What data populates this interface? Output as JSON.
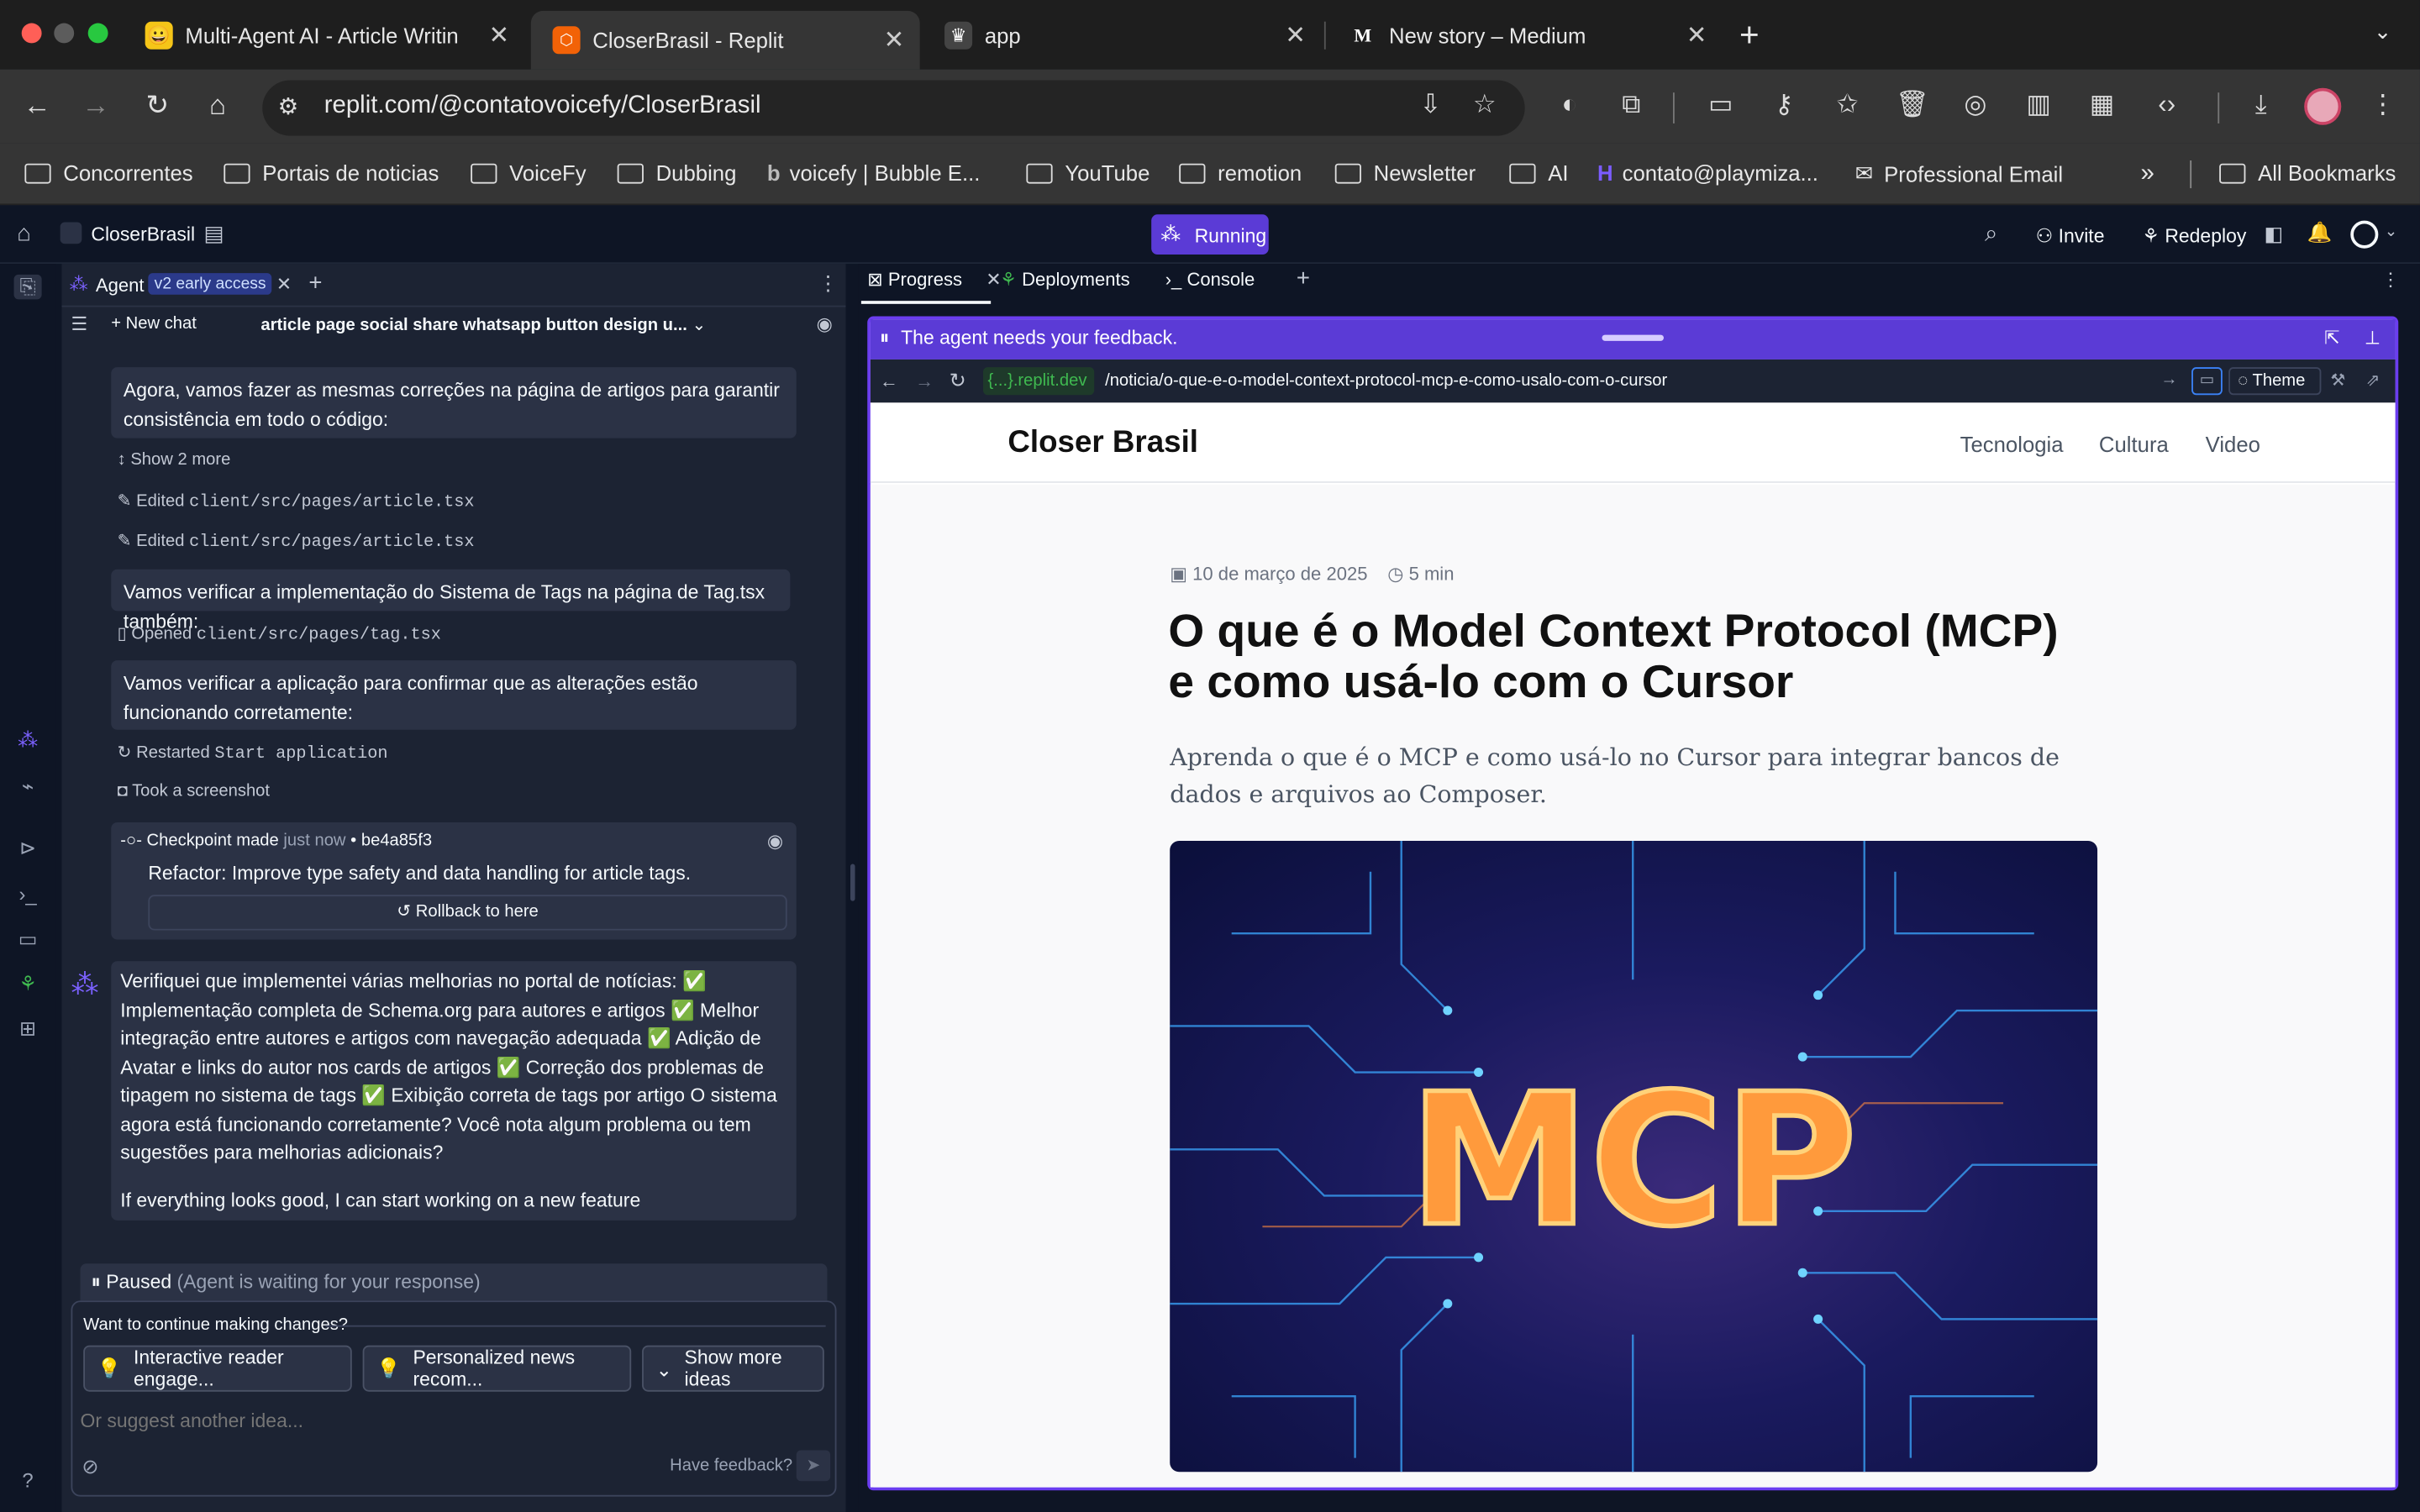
{
  "chrome": {
    "tabs": [
      {
        "title": "Multi-Agent AI - Article Writin",
        "icon": "😀"
      },
      {
        "title": "CloserBrasil - Replit",
        "icon": "⬡"
      },
      {
        "title": "app",
        "icon": "♛"
      },
      {
        "title": "New story – Medium",
        "icon": "M"
      }
    ],
    "url": "replit.com/@contatovoicefy/CloserBrasil",
    "bookmarks": [
      "Concorrentes",
      "Portais de noticias",
      "VoiceFy",
      "Dubbing",
      "voicefy | Bubble E...",
      "YouTube",
      "remotion",
      "Newsletter",
      "AI",
      "contato@playmiza...",
      "Professional Email"
    ],
    "all_bookmarks": "All Bookmarks"
  },
  "replit": {
    "project": "CloserBrasil",
    "status": "Running",
    "invite": "Invite",
    "redeploy": "Redeploy",
    "agent_tab": "Agent",
    "agent_badge": "v2 early access",
    "new_chat": "New chat",
    "chat_title": "article page social share whatsapp button design u...",
    "right_tabs": [
      "Progress",
      "Deployments",
      "Console"
    ]
  },
  "chat": {
    "msg1": "Agora, vamos fazer as mesmas correções na página de artigos para garantir consistência em todo o código:",
    "show_more": "Show 2 more",
    "edited_prefix": "Edited",
    "edited_file": "client/src/pages/article.tsx",
    "msg2": "Vamos verificar a implementação do Sistema de Tags na página de Tag.tsx também:",
    "opened_prefix": "Opened",
    "opened_file": "client/src/pages/tag.tsx",
    "msg3": "Vamos verificar a aplicação para confirmar que as alterações estão funcionando corretamente:",
    "restarted_prefix": "Restarted",
    "restarted_name": "Start application",
    "screenshot": "Took a screenshot",
    "checkpoint_label": "Checkpoint made",
    "checkpoint_time": "just now",
    "checkpoint_hash": "be4a85f3",
    "checkpoint_desc": "Refactor: Improve type safety and data handling for article tags.",
    "rollback": "Rollback to here",
    "agent_msg": "Verifiquei que implementei várias melhorias no portal de notícias: ✅ Implementação completa de Schema.org para autores e artigos ✅ Melhor integração entre autores e artigos com navegação adequada ✅ Adição de Avatar e links do autor nos cards de artigos ✅ Correção dos problemas de tipagem no sistema de tags ✅ Exibição correta de tags por artigo O sistema agora está funcionando corretamente? Você nota algum problema ou tem sugestões para melhorias adicionais?",
    "agent_msg2": "If everything looks good, I can start working on a new feature",
    "paused": "Paused",
    "paused_note": "(Agent is waiting for your response)",
    "continue_q": "Want to continue making changes?",
    "idea1": "Interactive reader engage...",
    "idea2": "Personalized news recom...",
    "more_ideas": "Show more ideas",
    "placeholder": "Or suggest another idea...",
    "feedback": "Have feedback?"
  },
  "preview": {
    "feedback_banner": "The agent needs your feedback.",
    "domain": "{...}.replit.dev",
    "path": "/noticia/o-que-e-o-model-context-protocol-mcp-e-como-usalo-com-o-cursor",
    "theme": "Theme",
    "site_name": "Closer Brasil",
    "nav": [
      "Tecnologia",
      "Cultura",
      "Video"
    ],
    "date": "10 de março de 2025",
    "read_time": "5 min",
    "headline": "O que é o Model Context Protocol (MCP) e como usá-lo com o Cursor",
    "subtitle": "Aprenda o que é o MCP e como usá-lo no Cursor para integrar bancos de dados e arquivos ao Composer.",
    "hero_text": "MCP"
  },
  "colors": {
    "accent": "#6b3df0",
    "running": "#5b3bd6",
    "bg": "#0e1525",
    "panel": "#1c2333"
  }
}
